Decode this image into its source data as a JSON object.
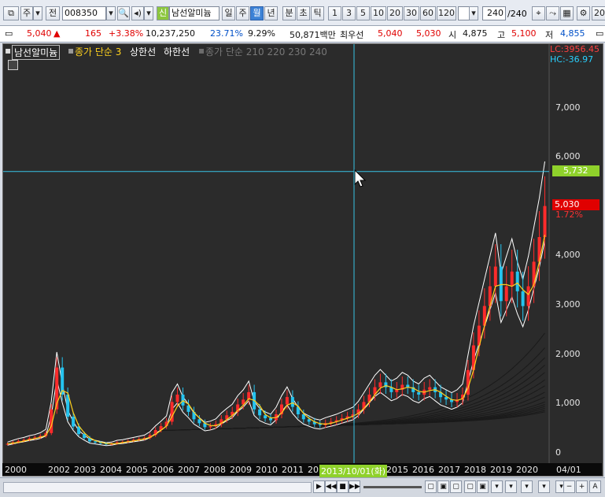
{
  "toolbar": {
    "type_label": "주",
    "market_label": "전",
    "code_value": "008350",
    "new_badge": "신",
    "stock_name": "남선알미늄",
    "periods": [
      "일",
      "주",
      "월",
      "년",
      "분",
      "초",
      "틱"
    ],
    "active_period": "월",
    "intervals": [
      "1",
      "3",
      "5",
      "10",
      "20",
      "30",
      "60",
      "120"
    ],
    "count_value": "240",
    "count_total": "/240",
    "right_end": "20"
  },
  "quote": {
    "price": "5,040",
    "change_arrow": "▲",
    "change": "165",
    "change_pct": "+3.38%",
    "volume": "10,237,250",
    "ratio1": "23.71%",
    "ratio2": "9.29%",
    "amount": "50,871백만",
    "preferred_label": "최우선",
    "bid1": "5,040",
    "bid2": "5,030",
    "open_label": "시",
    "open": "4,875",
    "high_label": "고",
    "high": "5,100",
    "low_label": "저",
    "low": "4,855"
  },
  "legend": {
    "name": "남선알미늄",
    "ma_label": "종가 단순 3",
    "upper_label": "상한선",
    "lower_label": "하한선",
    "ma_long_label": "종가 단순 210  220  230  240",
    "lc": "LC:3956.45",
    "hc": "HC:-36.97"
  },
  "price_tags": {
    "cursor_price": "5,732",
    "last_price": "5,030",
    "last_pct": "1.72%"
  },
  "colors": {
    "up": "#ff2b2b",
    "down": "#24c4f0",
    "ma": "#ffd21e",
    "cursor_tag": "#8fd12b",
    "last_tag": "#e00000"
  },
  "chart_data": {
    "type": "candlestick",
    "y_axis_ticks": [
      "7,000",
      "6,000",
      "5,000",
      "4,000",
      "3,000",
      "2,000",
      "1,000",
      "0"
    ],
    "x_axis_labels": [
      "2000",
      "2002",
      "2003",
      "2004",
      "2005",
      "2006",
      "2007",
      "2008",
      "2009",
      "2010",
      "2011",
      "20",
      "2015",
      "2016",
      "2017",
      "2018",
      "2019",
      "2020",
      "04/01"
    ],
    "cursor_date": "2013/10/01(화)",
    "cursor_price": 5732,
    "ylim": [
      0,
      7600
    ],
    "close_series": [
      200,
      230,
      260,
      280,
      310,
      330,
      360,
      420,
      900,
      1750,
      1200,
      750,
      550,
      400,
      320,
      250,
      230,
      210,
      190,
      200,
      230,
      240,
      260,
      280,
      300,
      320,
      380,
      480,
      560,
      650,
      1050,
      1200,
      980,
      850,
      700,
      620,
      540,
      560,
      600,
      700,
      780,
      850,
      1000,
      1100,
      1250,
      900,
      780,
      720,
      680,
      800,
      1000,
      1150,
      950,
      800,
      700,
      650,
      600,
      580,
      620,
      650,
      680,
      720,
      760,
      800,
      900,
      1050,
      1200,
      1350,
      1450,
      1350,
      1250,
      1300,
      1400,
      1350,
      1250,
      1200,
      1300,
      1350,
      1250,
      1150,
      1100,
      1050,
      1100,
      1200,
      1700,
      2200,
      2600,
      3000,
      3400,
      3800,
      3100,
      3400,
      3700,
      3300,
      3000,
      3400,
      3900,
      4400,
      5030
    ],
    "ma_upper_levels": [
      2450,
      2150,
      1950,
      1800,
      1650,
      1500,
      1380,
      1250,
      1150
    ],
    "ma_lower_levels": [
      1050,
      1000,
      960,
      920,
      880,
      850
    ]
  },
  "statusbar": {
    "play": "▶",
    "rewind": "◀◀",
    "stop": "■",
    "forward": "▶▶",
    "minus": "−",
    "plus": "+",
    "font_a": "A"
  }
}
